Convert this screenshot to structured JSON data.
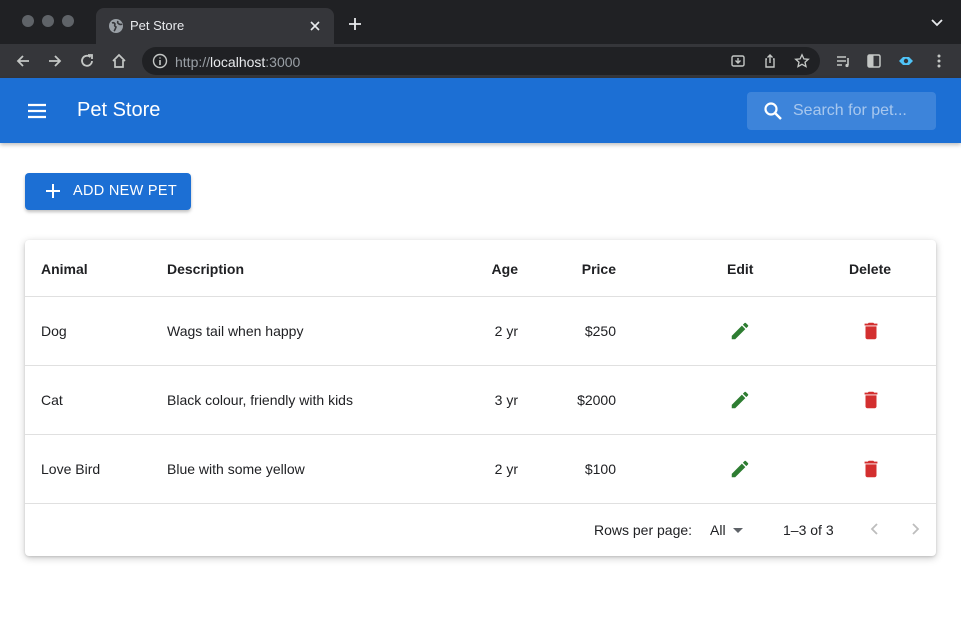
{
  "browser": {
    "tab_title": "Pet Store",
    "url_scheme": "http://",
    "url_host": "localhost",
    "url_port": ":3000"
  },
  "appbar": {
    "title": "Pet Store",
    "search_placeholder": "Search for pet...",
    "color": "#1c6fd4"
  },
  "actions": {
    "add_label": "ADD NEW PET"
  },
  "table": {
    "columns": {
      "animal": "Animal",
      "description": "Description",
      "age": "Age",
      "price": "Price",
      "edit": "Edit",
      "delete": "Delete"
    },
    "rows": [
      {
        "animal": "Dog",
        "description": "Wags tail when happy",
        "age": "2 yr",
        "price": "$250"
      },
      {
        "animal": "Cat",
        "description": "Black colour, friendly with kids",
        "age": "3 yr",
        "price": "$2000"
      },
      {
        "animal": "Love Bird",
        "description": "Blue with some yellow",
        "age": "2 yr",
        "price": "$100"
      }
    ],
    "edit_icon_color": "#2e7d32",
    "delete_icon_color": "#d32f2f"
  },
  "pagination": {
    "rows_per_page_label": "Rows per page:",
    "rows_per_page_value": "All",
    "page_info": "1–3 of 3"
  },
  "icons": {
    "menu": "menu-icon",
    "search": "search-icon",
    "add": "plus-icon",
    "edit": "pencil-icon",
    "delete": "trash-icon",
    "prev": "chevron-left-icon",
    "next": "chevron-right-icon"
  }
}
